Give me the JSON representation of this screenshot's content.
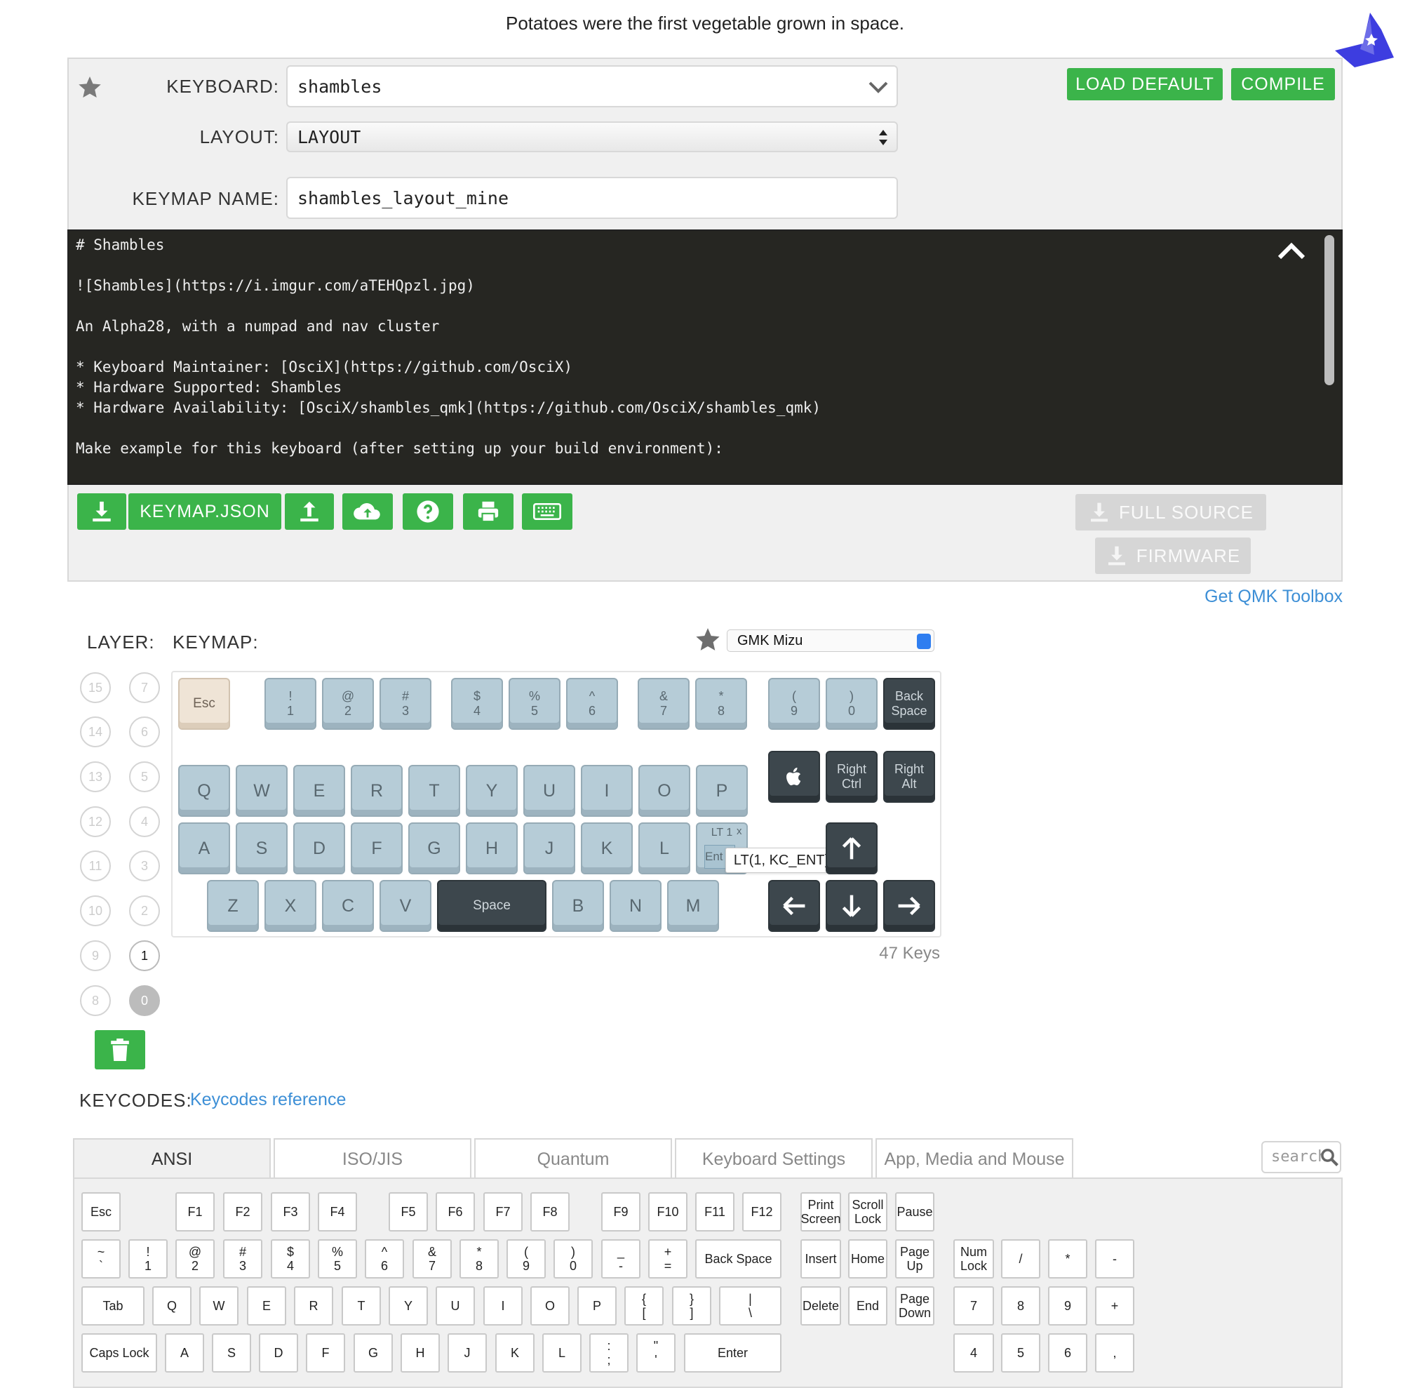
{
  "fact_banner": "Potatoes were the first vegetable grown in space.",
  "colors": {
    "accent_green": "#3bb44a",
    "link_blue": "#3d8fd6",
    "readme_bg": "#262622",
    "wizard_blue": "#3d3de0"
  },
  "form": {
    "keyboard_label": "KEYBOARD:",
    "keyboard_value": "shambles",
    "layout_label": "LAYOUT:",
    "layout_value": "LAYOUT",
    "keymap_name_label": "KEYMAP NAME:",
    "keymap_name_value": "shambles_layout_mine"
  },
  "actions": {
    "load_default": "LOAD DEFAULT",
    "compile": "COMPILE",
    "keymap_json": "KEYMAP.JSON",
    "full_source": "FULL SOURCE",
    "firmware": "FIRMWARE"
  },
  "readme": [
    "# Shambles",
    "",
    "![Shambles](https://i.imgur.com/aTEHQpzl.jpg)",
    "",
    "An Alpha28, with a numpad and nav cluster",
    "",
    "* Keyboard Maintainer: [OsciX](https://github.com/OsciX)",
    "* Hardware Supported: Shambles",
    "* Hardware Availability: [OsciX/shambles_qmk](https://github.com/OsciX/shambles_qmk)",
    "",
    "Make example for this keyboard (after setting up your build environment):"
  ],
  "toolbox_link": "Get QMK Toolbox",
  "keymap_section": {
    "layer_label": "LAYER:",
    "keymap_label": "KEYMAP:",
    "theme": "GMK Mizu",
    "key_count": "47 Keys",
    "tooltip": "LT(1, KC_ENT)",
    "layers": [
      "15",
      "7",
      "14",
      "6",
      "13",
      "5",
      "12",
      "4",
      "11",
      "3",
      "10",
      "2",
      "9",
      "1",
      "8",
      "0"
    ],
    "keys": {
      "esc": "Esc",
      "n1": [
        "!",
        "1"
      ],
      "n2": [
        "@",
        "2"
      ],
      "n3": [
        "#",
        "3"
      ],
      "n4": [
        "$",
        "4"
      ],
      "n5": [
        "%",
        "5"
      ],
      "n6": [
        "^",
        "6"
      ],
      "n7": [
        "&",
        "7"
      ],
      "n8": [
        "*",
        "8"
      ],
      "n9": [
        "(",
        "9"
      ],
      "n0": [
        ")",
        "0"
      ],
      "backspace": [
        "Back",
        "Space"
      ],
      "row2": [
        "Q",
        "W",
        "E",
        "R",
        "T",
        "Y",
        "U",
        "I",
        "O",
        "P"
      ],
      "right_ctrl": [
        "Right",
        "Ctrl"
      ],
      "right_alt": [
        "Right",
        "Alt"
      ],
      "row3": [
        "A",
        "S",
        "D",
        "F",
        "G",
        "H",
        "J",
        "K",
        "L"
      ],
      "lt_top": "LT 1",
      "lt_close": "x",
      "lt_bottom": "Ent",
      "row4a": [
        "Z",
        "X",
        "C",
        "V"
      ],
      "space": "Space",
      "row4b": [
        "B",
        "N",
        "M"
      ]
    }
  },
  "keycodes": {
    "label": "KEYCODES:",
    "reference_link": "Keycodes reference",
    "tabs": [
      "ANSI",
      "ISO/JIS",
      "Quantum",
      "Keyboard Settings",
      "App, Media and Mouse"
    ],
    "search_placeholder": "search",
    "row1": [
      "Esc",
      "F1",
      "F2",
      "F3",
      "F4",
      "F5",
      "F6",
      "F7",
      "F8",
      "F9",
      "F10",
      "F11",
      "F12",
      "Print Screen",
      "Scroll Lock",
      "Pause"
    ],
    "row2": [
      [
        "~",
        "`"
      ],
      [
        "!",
        "1"
      ],
      [
        "@",
        "2"
      ],
      [
        "#",
        "3"
      ],
      [
        "$",
        "4"
      ],
      [
        "%",
        "5"
      ],
      [
        "^",
        "6"
      ],
      [
        "&",
        "7"
      ],
      [
        "*",
        "8"
      ],
      [
        "(",
        "9"
      ],
      [
        ")",
        "0"
      ],
      [
        "_",
        "-"
      ],
      [
        "+",
        "="
      ],
      [
        "Back Space",
        ""
      ],
      [
        "Insert",
        ""
      ],
      [
        "Home",
        ""
      ],
      [
        "Page",
        "Up"
      ],
      [
        "Num",
        "Lock"
      ],
      [
        "/",
        ""
      ],
      [
        "*",
        ""
      ],
      [
        "-",
        ""
      ]
    ],
    "row3": [
      [
        "Tab",
        ""
      ],
      [
        "Q",
        ""
      ],
      [
        "W",
        ""
      ],
      [
        "E",
        ""
      ],
      [
        "R",
        ""
      ],
      [
        "T",
        ""
      ],
      [
        "Y",
        ""
      ],
      [
        "U",
        ""
      ],
      [
        "I",
        ""
      ],
      [
        "O",
        ""
      ],
      [
        "P",
        ""
      ],
      [
        "{",
        "["
      ],
      [
        "}",
        "]"
      ],
      [
        "|",
        "\\"
      ],
      [
        "Delete",
        ""
      ],
      [
        "End",
        ""
      ],
      [
        "Page",
        "Down"
      ],
      [
        "7",
        ""
      ],
      [
        "8",
        ""
      ],
      [
        "9",
        ""
      ],
      [
        "+",
        ""
      ]
    ],
    "row4": [
      [
        "Caps Lock",
        ""
      ],
      [
        "A",
        ""
      ],
      [
        "S",
        ""
      ],
      [
        "D",
        ""
      ],
      [
        "F",
        ""
      ],
      [
        "G",
        ""
      ],
      [
        "H",
        ""
      ],
      [
        "J",
        ""
      ],
      [
        "K",
        ""
      ],
      [
        "L",
        ""
      ],
      [
        ":",
        ";"
      ],
      [
        "\"",
        "'"
      ],
      [
        "Enter",
        ""
      ],
      [
        "4",
        ""
      ],
      [
        "5",
        ""
      ],
      [
        "6",
        ""
      ],
      [
        ",",
        ""
      ]
    ]
  }
}
